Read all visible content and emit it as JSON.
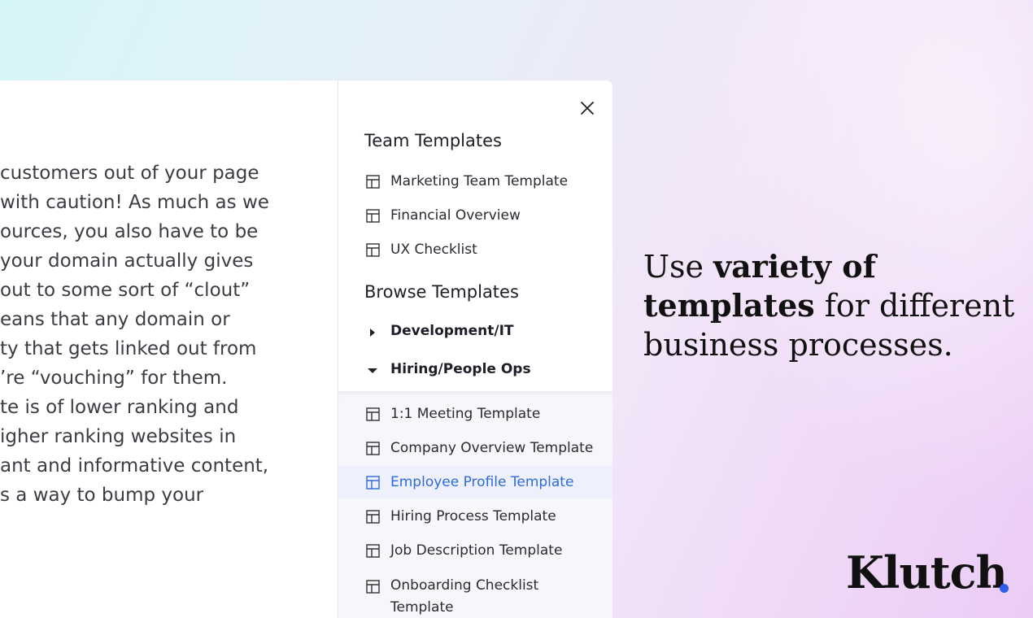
{
  "document": {
    "lines": [
      "customers out of your page",
      " with caution! As much as we",
      "ources, you also have to be",
      " your domain actually gives",
      "out to some sort of “clout”",
      "eans that any domain or",
      "ty that gets linked out from",
      "’re “vouching” for them.",
      "te is of lower ranking and",
      "igher ranking websites in",
      "ant and informative content,",
      "s a way to bump your"
    ]
  },
  "panel": {
    "close_icon": "close-icon",
    "team_title": "Team Templates",
    "team_items": [
      {
        "label": "Marketing Team Template",
        "icon": "template-icon"
      },
      {
        "label": "Financial Overview",
        "icon": "template-icon"
      },
      {
        "label": "UX Checklist",
        "icon": "template-icon"
      }
    ],
    "browse_title": "Browse Templates",
    "categories": [
      {
        "label": "Development/IT",
        "expanded": false
      },
      {
        "label": "Hiring/People Ops",
        "expanded": true
      }
    ],
    "hiring_items": [
      {
        "label": "1:1 Meeting Template"
      },
      {
        "label": "Company Overview Template"
      },
      {
        "label": "Employee Profile Template",
        "active": true
      },
      {
        "label": "Hiring Process Template"
      },
      {
        "label": "Job Description Template"
      },
      {
        "label": "Onboarding Checklist Template"
      }
    ]
  },
  "headline": {
    "part1": "Use ",
    "bold1": "variety of",
    "bold2": "templates",
    "part2": " for different",
    "part3": "business processes."
  },
  "brand": {
    "name": "Klutch",
    "dot_color": "#2f5df0"
  },
  "colors": {
    "accent": "#2f6bd8",
    "active_bg": "#eef1fb"
  }
}
